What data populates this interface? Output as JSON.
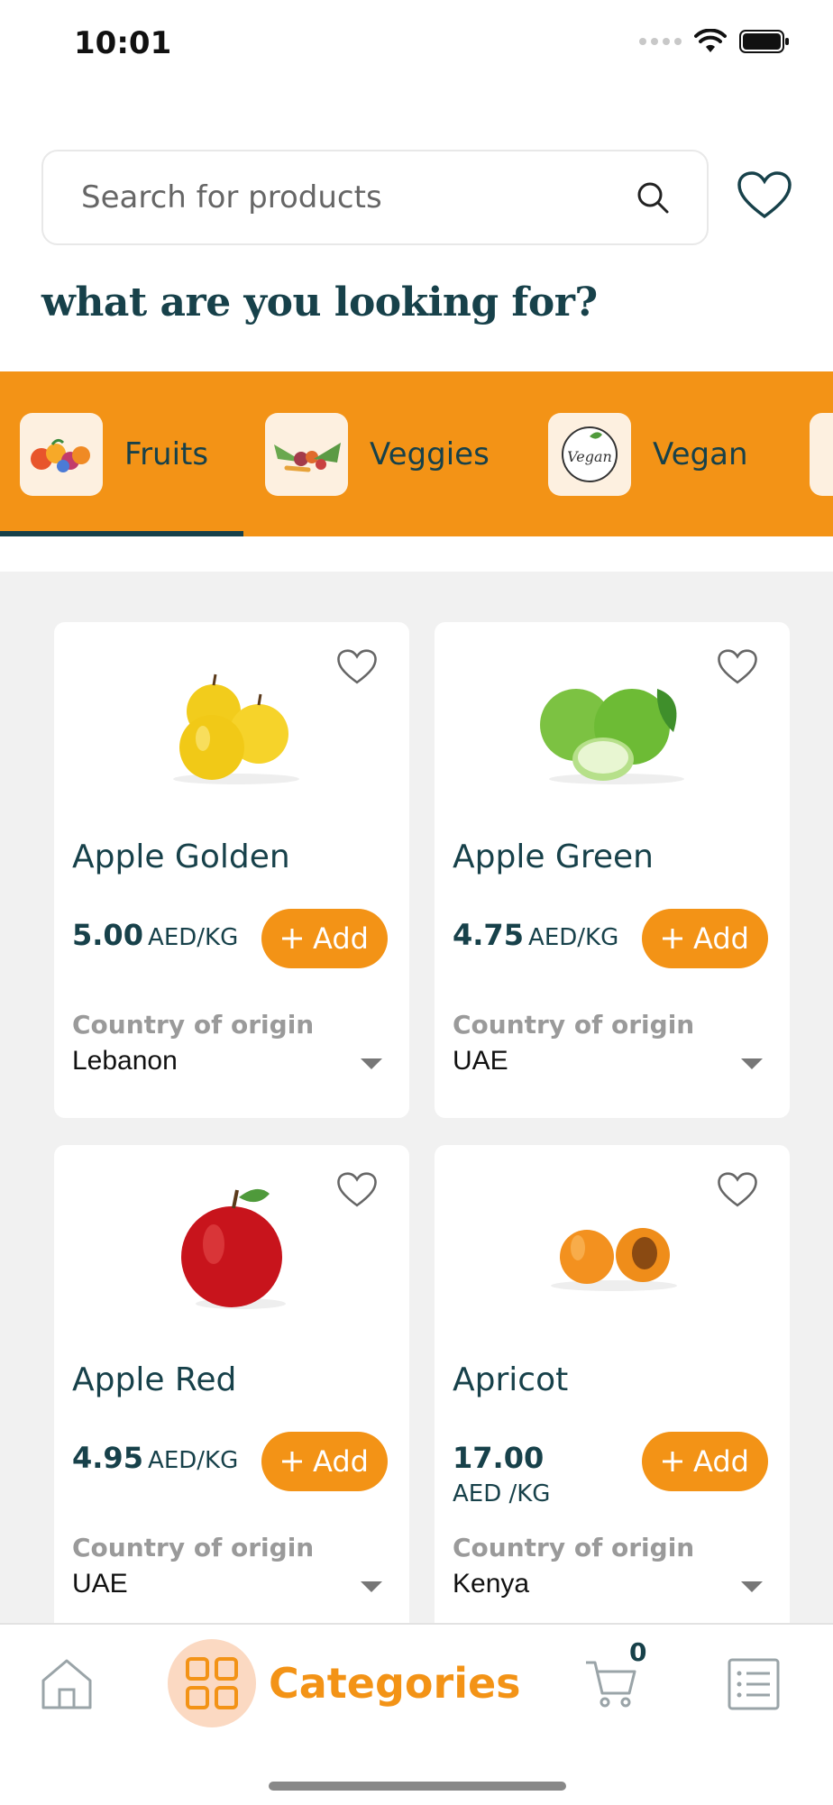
{
  "status_bar": {
    "time": "10:01"
  },
  "search": {
    "placeholder": "Search for products"
  },
  "headline": "what are you looking for?",
  "categories_tabs": [
    {
      "label": "Fruits",
      "icon": "fruits-thumbnail"
    },
    {
      "label": "Veggies",
      "icon": "veggies-thumbnail"
    },
    {
      "label": "Vegan",
      "icon": "vegan-thumbnail",
      "thumb_text": "Vegan"
    }
  ],
  "products": [
    {
      "name": "Apple Golden",
      "price": "5.00",
      "unit": "AED/KG",
      "add_label": "Add",
      "origin_label": "Country of origin",
      "origin": "Lebanon"
    },
    {
      "name": "Apple Green",
      "price": "4.75",
      "unit": "AED/KG",
      "add_label": "Add",
      "origin_label": "Country of origin",
      "origin": "UAE"
    },
    {
      "name": "Apple Red",
      "price": "4.95",
      "unit": "AED/KG",
      "add_label": "Add",
      "origin_label": "Country of origin",
      "origin": "UAE"
    },
    {
      "name": "Apricot",
      "price": "17.00",
      "unit": "AED /KG",
      "add_label": "Add",
      "origin_label": "Country of origin",
      "origin": "Kenya"
    }
  ],
  "bottom_nav": {
    "categories_label": "Categories",
    "cart_count": "0"
  },
  "colors": {
    "accent": "#f39316",
    "text": "#17414a",
    "background": "#f1f1f1"
  }
}
